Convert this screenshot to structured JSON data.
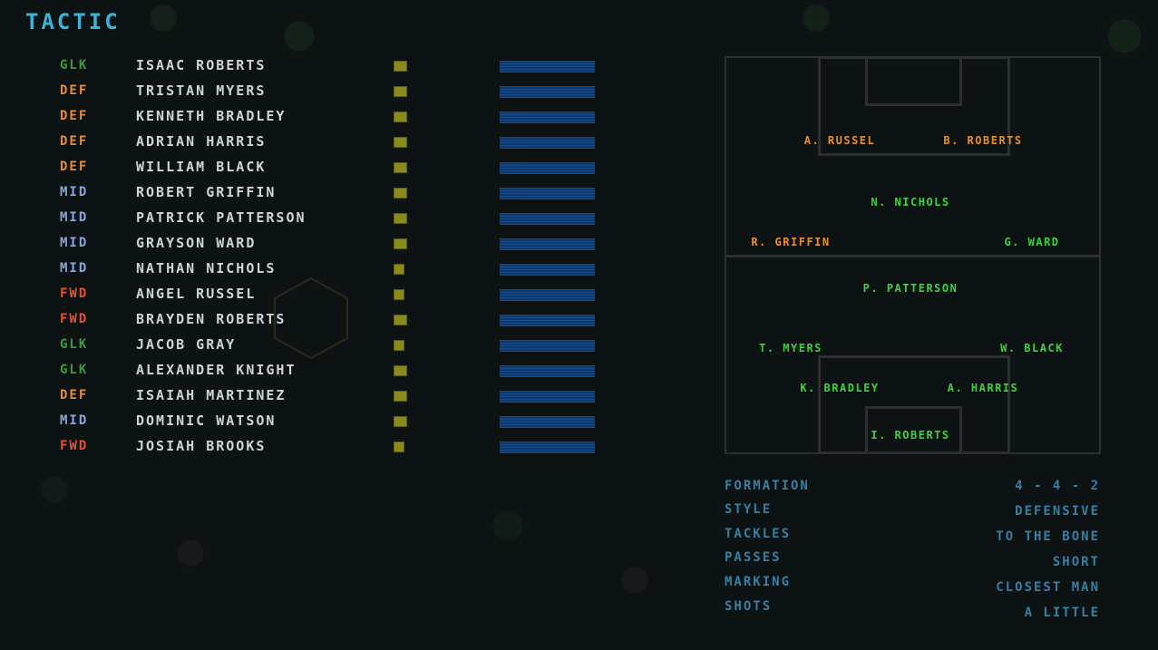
{
  "title": "TACTIC",
  "colors": {
    "GLK": "#3d9a3d",
    "DEF": "#e88a3c",
    "MID": "#8aa6e0",
    "FWD": "#e8502e",
    "pitch_green": "#3ed23e",
    "pitch_orange": "#e8902e"
  },
  "players": [
    {
      "pos": "GLK",
      "name": "ISAAC ROBERTS",
      "sq": "big"
    },
    {
      "pos": "DEF",
      "name": "TRISTAN MYERS",
      "sq": "big"
    },
    {
      "pos": "DEF",
      "name": "KENNETH BRADLEY",
      "sq": "big"
    },
    {
      "pos": "DEF",
      "name": "ADRIAN HARRIS",
      "sq": "big"
    },
    {
      "pos": "DEF",
      "name": "WILLIAM BLACK",
      "sq": "big"
    },
    {
      "pos": "MID",
      "name": "ROBERT GRIFFIN",
      "sq": "big"
    },
    {
      "pos": "MID",
      "name": "PATRICK PATTERSON",
      "sq": "big"
    },
    {
      "pos": "MID",
      "name": "GRAYSON WARD",
      "sq": "big"
    },
    {
      "pos": "MID",
      "name": "NATHAN NICHOLS",
      "sq": "small"
    },
    {
      "pos": "FWD",
      "name": "ANGEL RUSSEL",
      "sq": "small"
    },
    {
      "pos": "FWD",
      "name": "BRAYDEN ROBERTS",
      "sq": "big"
    },
    {
      "pos": "GLK",
      "name": "JACOB GRAY",
      "sq": "small"
    },
    {
      "pos": "GLK",
      "name": "ALEXANDER KNIGHT",
      "sq": "big"
    },
    {
      "pos": "DEF",
      "name": "ISAIAH MARTINEZ",
      "sq": "big"
    },
    {
      "pos": "MID",
      "name": "DOMINIC WATSON",
      "sq": "big"
    },
    {
      "pos": "FWD",
      "name": "JOSIAH BROOKS",
      "sq": "small"
    }
  ],
  "pitch": [
    {
      "label": "A. RUSSEL",
      "color": "orange"
    },
    {
      "label": "B. ROBERTS",
      "color": "orange"
    },
    {
      "label": "N. NICHOLS",
      "color": "green"
    },
    {
      "label": "R. GRIFFIN",
      "color": "orange"
    },
    {
      "label": "G. WARD",
      "color": "green"
    },
    {
      "label": "P. PATTERSON",
      "color": "green"
    },
    {
      "label": "T. MYERS",
      "color": "green"
    },
    {
      "label": "W. BLACK",
      "color": "green"
    },
    {
      "label": "K. BRADLEY",
      "color": "green"
    },
    {
      "label": "A. HARRIS",
      "color": "green"
    },
    {
      "label": "I. ROBERTS",
      "color": "green"
    }
  ],
  "tactics": {
    "formation_label": "FORMATION",
    "formation": "4 - 4 - 2",
    "style_label": "STYLE",
    "style": "DEFENSIVE",
    "tackles_label": "TACKLES",
    "tackles": "TO THE BONE",
    "passes_label": "PASSES",
    "passes": "SHORT",
    "marking_label": "MARKING",
    "marking": "CLOSEST MAN",
    "shots_label": "SHOTS",
    "shots": "A LITTLE"
  }
}
